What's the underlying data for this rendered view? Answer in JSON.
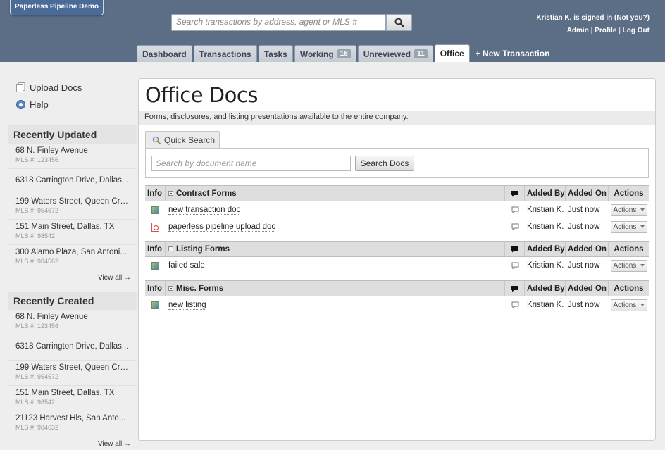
{
  "brand": "Paperless Pipeline Demo",
  "search": {
    "placeholder": "Search transactions by address, agent or MLS #"
  },
  "user": {
    "signed_in": "Kristian K. is signed in",
    "not_you": "(Not you?)",
    "admin": "Admin",
    "profile": "Profile",
    "logout": "Log Out",
    "sep": "|"
  },
  "tabs": [
    {
      "label": "Dashboard"
    },
    {
      "label": "Transactions"
    },
    {
      "label": "Tasks"
    },
    {
      "label": "Working",
      "badge": "18"
    },
    {
      "label": "Unreviewed",
      "badge": "11"
    },
    {
      "label": "Office",
      "active": true
    },
    {
      "label": "+ New Transaction"
    }
  ],
  "sidebar": {
    "links": [
      {
        "label": "Upload Docs"
      },
      {
        "label": "Help"
      }
    ],
    "recently_updated": {
      "title": "Recently Updated",
      "items": [
        {
          "address": "68 N. Finley Avenue",
          "mls": "MLS #: 123456"
        },
        {
          "address": "6318 Carrington Drive, Dallas...",
          "mls": ""
        },
        {
          "address": "199 Waters Street, Queen Cre...",
          "mls": "MLS #: 954672"
        },
        {
          "address": "151 Main Street, Dallas, TX",
          "mls": "MLS #: 98542"
        },
        {
          "address": "300 Alamo Plaza, San Antoni...",
          "mls": "MLS #: 984562"
        }
      ],
      "view_all": "View all →"
    },
    "recently_created": {
      "title": "Recently Created",
      "items": [
        {
          "address": "68 N. Finley Avenue",
          "mls": "MLS #: 123456"
        },
        {
          "address": "6318 Carrington Drive, Dallas...",
          "mls": ""
        },
        {
          "address": "199 Waters Street, Queen Cre...",
          "mls": "MLS #: 954672"
        },
        {
          "address": "151 Main Street, Dallas, TX",
          "mls": "MLS #: 98542"
        },
        {
          "address": "21123 Harvest Hls, San Anto...",
          "mls": "MLS #: 984632"
        }
      ],
      "view_all": "View all →"
    }
  },
  "main": {
    "title": "Office Docs",
    "subtitle": "Forms, disclosures, and listing presentations available to the entire company.",
    "quick_search": {
      "tab": "Quick Search",
      "placeholder": "Search by document name",
      "button": "Search Docs"
    },
    "columns": {
      "info": "Info",
      "added_by": "Added By",
      "added_on": "Added On",
      "actions": "Actions"
    },
    "groups": [
      {
        "name": "Contract Forms",
        "docs": [
          {
            "name": "new transaction doc",
            "icon": "image-doc-icon",
            "added_by": "Kristian K.",
            "added_on": "Just now",
            "action": "Actions"
          },
          {
            "name": "paperless pipeline upload doc",
            "icon": "pdf-icon",
            "added_by": "Kristian K.",
            "added_on": "Just now",
            "action": "Actions"
          }
        ]
      },
      {
        "name": "Listing Forms",
        "docs": [
          {
            "name": "failed sale",
            "icon": "image-doc-icon",
            "added_by": "Kristian K.",
            "added_on": "Just now",
            "action": "Actions"
          }
        ]
      },
      {
        "name": "Misc. Forms",
        "docs": [
          {
            "name": "new listing",
            "icon": "image-doc-icon",
            "added_by": "Kristian K.",
            "added_on": "Just now",
            "action": "Actions"
          }
        ]
      }
    ]
  }
}
